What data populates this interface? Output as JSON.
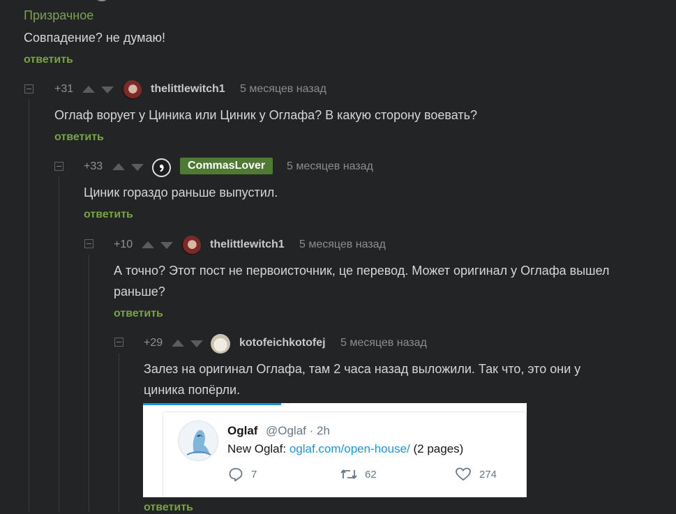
{
  "comment0": {
    "author": "Призрачное",
    "text": "Совпадение? не думаю!",
    "reply": "ответить"
  },
  "comment1": {
    "rating": "+31",
    "author": "thelittlewitch1",
    "time": "5 месяцев назад",
    "text": "Оглаф ворует у Циника или Циник у Оглафа? В какую сторону воевать?",
    "reply": "ответить"
  },
  "comment2": {
    "rating": "+33",
    "author": "CommasLover",
    "time": "5 месяцев назад",
    "text": "Циник гораздо раньше выпустил.",
    "reply": "ответить"
  },
  "comment3": {
    "rating": "+10",
    "author": "thelittlewitch1",
    "time": "5 месяцев назад",
    "text_line1": "А точно? Этот пост не первоисточник, це перевод. Может оригинал у Оглафа вышел",
    "text_line2": "раньше?",
    "reply": "ответить"
  },
  "comment4": {
    "rating": "+29",
    "author": "kotofeichkotofej",
    "time": "5 месяцев назад",
    "text_line1": "Залез на оригинал Оглафа, там 2 часа назад выложили. Так что, это они у",
    "text_line2": "циника попёрли.",
    "reply": "ответить"
  },
  "tweet": {
    "name": "Oglaf",
    "handle": "@Oglaf · 2h",
    "text_prefix": "New Oglaf: ",
    "link": "oglaf.com/open-house/",
    "text_suffix": " (2 pages)",
    "replies": "7",
    "retweets": "62",
    "likes": "274"
  },
  "icons": {
    "collapse": "minus-square-icon",
    "upvote": "triangle-up-icon",
    "downvote": "triangle-down-icon",
    "reply_tweet": "speech-bubble-icon",
    "retweet": "retweet-icon",
    "like": "heart-icon"
  },
  "colors": {
    "background": "#232425",
    "reply_link": "#7aa246",
    "badge": "#4f7a33",
    "twitter_blue": "#1b95e0"
  }
}
